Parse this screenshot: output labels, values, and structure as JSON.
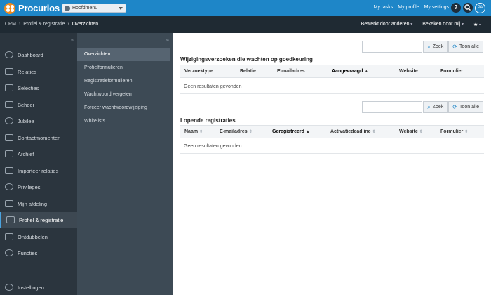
{
  "topbar": {
    "logo_text": "Procurios",
    "menu_select": "Hoofdmenu",
    "links": [
      "My tasks",
      "My profile",
      "My settings"
    ],
    "help_icon": "?",
    "avatar": "PA"
  },
  "breadcrumb": {
    "items": [
      "CRM",
      "Profiel & registratie",
      "Overzichten"
    ],
    "actions": [
      "Bewerkt door anderen",
      "Bekeken door mij"
    ],
    "star": "★"
  },
  "sidebar": {
    "items": [
      {
        "label": "Dashboard",
        "icon": "search-icon"
      },
      {
        "label": "Relaties",
        "icon": "people-icon"
      },
      {
        "label": "Selecties",
        "icon": "selection-icon"
      },
      {
        "label": "Beheer",
        "icon": "tree-icon"
      },
      {
        "label": "Jubilea",
        "icon": "medal-icon"
      },
      {
        "label": "Contactmomenten",
        "icon": "chat-icon"
      },
      {
        "label": "Archief",
        "icon": "archive-icon"
      },
      {
        "label": "Importeer relaties",
        "icon": "import-icon"
      },
      {
        "label": "Privileges",
        "icon": "key-icon"
      },
      {
        "label": "Mijn afdeling",
        "icon": "clipboard-icon"
      },
      {
        "label": "Profiel & registratie",
        "icon": "profile-icon"
      },
      {
        "label": "Ontdubbelen",
        "icon": "merge-icon"
      },
      {
        "label": "Functies",
        "icon": "function-icon"
      },
      {
        "label": "Instellingen",
        "icon": "gear-icon"
      }
    ]
  },
  "subnav": {
    "items": [
      "Overzichten",
      "Profielformulieren",
      "Registratieformulieren",
      "Wachtwoord vergeten",
      "Forceer wachtwoordwijziging",
      "Whitelists"
    ]
  },
  "buttons": {
    "zoek": "Zoek",
    "toon_alle": "Toon alle"
  },
  "section1": {
    "title": "Wijzigingsverzoeken die wachten op goedkeuring",
    "columns": [
      "Verzoektype",
      "Relatie",
      "E-mailadres",
      "Aangevraagd",
      "Website",
      "Formulier"
    ],
    "empty": "Geen resultaten gevonden"
  },
  "section2": {
    "title": "Lopende registraties",
    "columns": [
      "Naam",
      "E-mailadres",
      "Geregistreerd",
      "Activatiedeadline",
      "Website",
      "Formulier"
    ],
    "empty": "Geen resultaten gevonden"
  },
  "colors": {
    "topbar": "#1e86c8",
    "crumbbar": "#1f2a33",
    "sidebar": "#2b353e",
    "subnav": "#3d4a55",
    "logo": "#f28a1c"
  }
}
